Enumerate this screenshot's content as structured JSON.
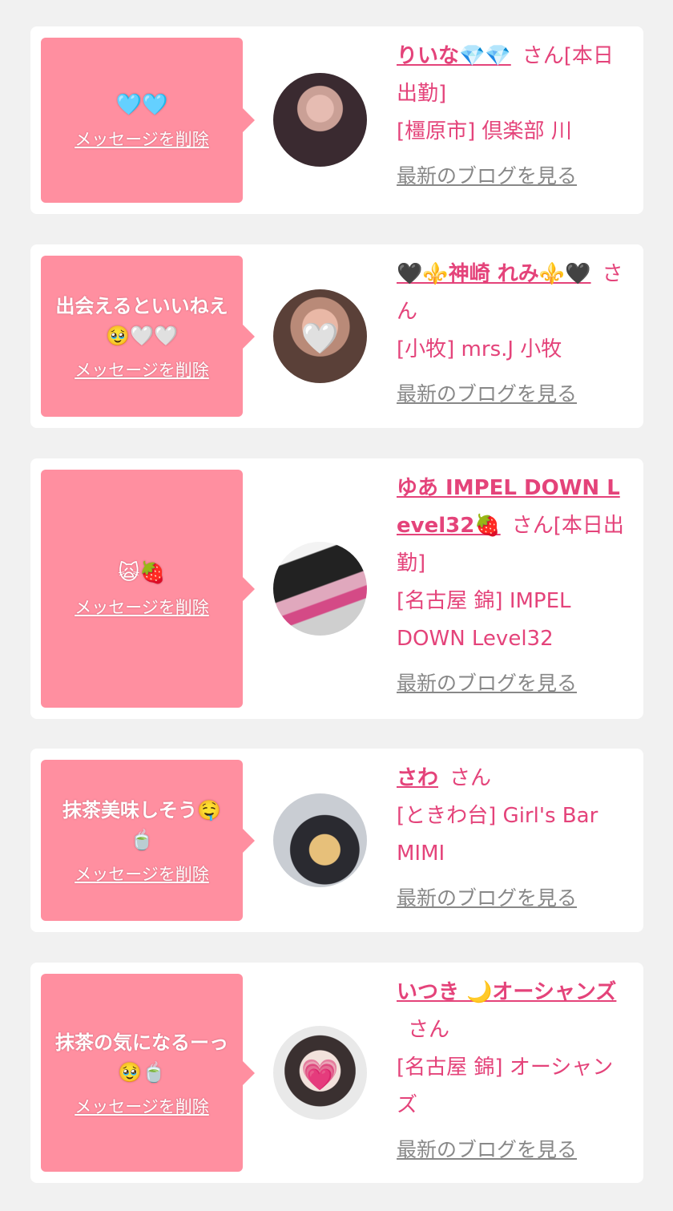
{
  "entries": [
    {
      "message": "🩵🩵",
      "delete_label": "メッセージを削除",
      "name": "りいな💎💎",
      "san": "さん[本日出勤]",
      "shop": "[橿原市] 倶楽部 川",
      "blog_label": "最新のブログを見る",
      "avatar_heart": ""
    },
    {
      "message": "出会えるといいねえ🥹🤍🤍",
      "delete_label": "メッセージを削除",
      "name": "🖤⚜️神崎 れみ⚜️🖤",
      "san": "さん",
      "shop": "[小牧] mrs.J 小牧",
      "blog_label": "最新のブログを見る",
      "avatar_heart": "🤍"
    },
    {
      "message": "🙀🍓",
      "delete_label": "メッセージを削除",
      "name": "ゆあ IMPEL DOWN Level32🍓",
      "san": "さん[本日出勤]",
      "shop": "[名古屋 錦] IMPEL DOWN Level32",
      "blog_label": "最新のブログを見る",
      "avatar_heart": ""
    },
    {
      "message": "抹茶美味しそう🤤🍵",
      "delete_label": "メッセージを削除",
      "name": "さわ",
      "san": "さん",
      "shop": "[ときわ台] Girl's Bar MIMI",
      "blog_label": "最新のブログを見る",
      "avatar_heart": ""
    },
    {
      "message": "抹茶の気になるーっ🥹🍵",
      "delete_label": "メッセージを削除",
      "name": "いつき 🌙オーシャンズ",
      "san": "さん",
      "shop": "[名古屋 錦] オーシャンズ",
      "blog_label": "最新のブログを見る",
      "avatar_heart": "💗"
    }
  ]
}
